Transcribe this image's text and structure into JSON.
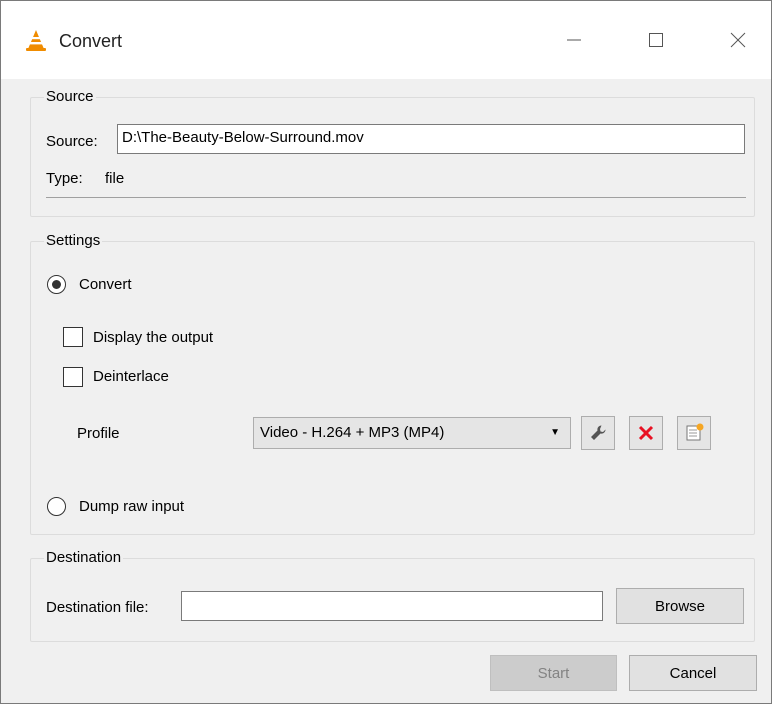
{
  "window": {
    "title": "Convert"
  },
  "source": {
    "legend": "Source",
    "source_label": "Source:",
    "source_value": "D:\\The-Beauty-Below-Surround.mov",
    "type_label": "Type:",
    "type_value": "file"
  },
  "settings": {
    "legend": "Settings",
    "convert_label": "Convert",
    "display_output_label": "Display the output",
    "deinterlace_label": "Deinterlace",
    "profile_label": "Profile",
    "profile_value": "Video - H.264 + MP3 (MP4)",
    "dump_raw_label": "Dump raw input",
    "convert_selected": true,
    "display_output_checked": false,
    "deinterlace_checked": false
  },
  "destination": {
    "legend": "Destination",
    "file_label": "Destination file:",
    "file_value": "",
    "browse_label": "Browse"
  },
  "buttons": {
    "start_label": "Start",
    "cancel_label": "Cancel"
  },
  "colors": {
    "delete_icon": "#e81123",
    "cone_orange": "#f08c00",
    "new_profile_accent": "#f5a623"
  }
}
